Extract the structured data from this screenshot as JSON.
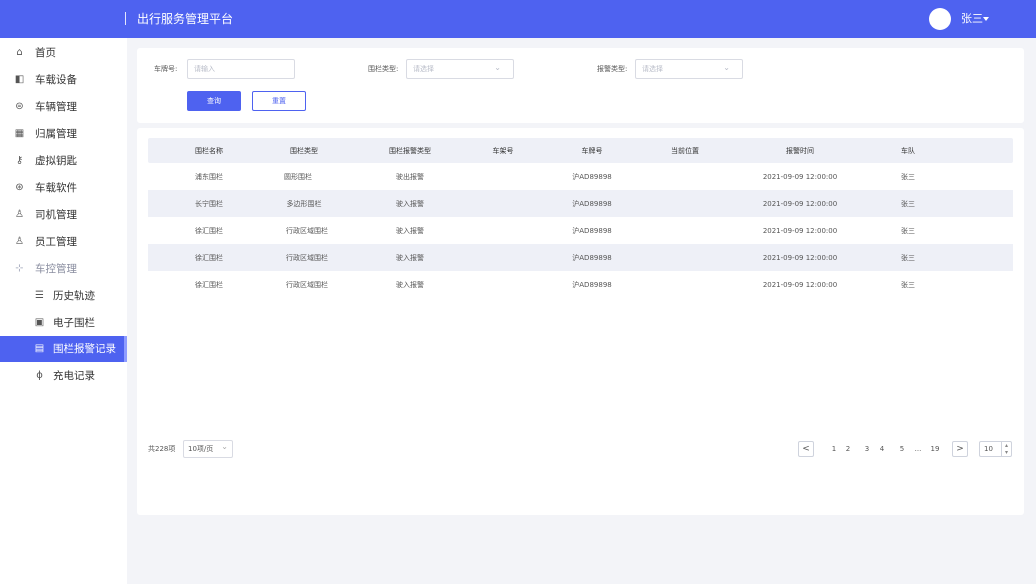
{
  "app": {
    "title": "出行服务管理平台",
    "user_name": "张三"
  },
  "sidebar": {
    "items": [
      {
        "label": "首页",
        "icon": "home-icon",
        "glyph": "⌂"
      },
      {
        "label": "车载设备",
        "icon": "device-icon",
        "glyph": "◧"
      },
      {
        "label": "车辆管理",
        "icon": "car-icon",
        "glyph": "⊜"
      },
      {
        "label": "归属管理",
        "icon": "grid-icon",
        "glyph": "▦"
      },
      {
        "label": "虚拟钥匙",
        "icon": "key-icon",
        "glyph": "⚷"
      },
      {
        "label": "车载软件",
        "icon": "cube-icon",
        "glyph": "⊛"
      },
      {
        "label": "司机管理",
        "icon": "driver-icon",
        "glyph": "♙"
      },
      {
        "label": "员工管理",
        "icon": "person-icon",
        "glyph": "♙"
      },
      {
        "label": "车控管理",
        "icon": "control-icon",
        "glyph": "⊹"
      },
      {
        "label": "历史轨迹",
        "icon": "list-icon",
        "glyph": "☰"
      },
      {
        "label": "电子围栏",
        "icon": "fence-icon",
        "glyph": "▣"
      },
      {
        "label": "围栏报警记录",
        "icon": "record-icon",
        "glyph": "▤"
      },
      {
        "label": "充电记录",
        "icon": "charge-icon",
        "glyph": "ϕ"
      }
    ]
  },
  "filter": {
    "plate_label": "车牌号:",
    "plate_placeholder": "请输入",
    "fence_type_label": "围栏类型:",
    "fence_type_placeholder": "请选择",
    "alarm_type_label": "报警类型:",
    "alarm_type_placeholder": "请选择",
    "search_label": "查询",
    "reset_label": "重置"
  },
  "table": {
    "columns": [
      "围栏名称",
      "围栏类型",
      "围栏报警类型",
      "车架号",
      "车牌号",
      "当前位置",
      "报警时间",
      "车队"
    ],
    "rows": [
      {
        "name": "浦东围栏",
        "type": "圆形围栏",
        "alarm": "驶出报警",
        "vin": "",
        "plate": "沪AD89898",
        "location": "",
        "time": "2021-09-09 12:00:00",
        "team": "张三"
      },
      {
        "name": "长宁围栏",
        "type": "多边形围栏",
        "alarm": "驶入报警",
        "vin": "",
        "plate": "沪AD89898",
        "location": "",
        "time": "2021-09-09 12:00:00",
        "team": "张三"
      },
      {
        "name": "徐汇围栏",
        "type": "行政区域围栏",
        "alarm": "驶入报警",
        "vin": "",
        "plate": "沪AD89898",
        "location": "",
        "time": "2021-09-09 12:00:00",
        "team": "张三"
      },
      {
        "name": "徐汇围栏",
        "type": "行政区域围栏",
        "alarm": "驶入报警",
        "vin": "",
        "plate": "沪AD89898",
        "location": "",
        "time": "2021-09-09 12:00:00",
        "team": "张三"
      },
      {
        "name": "徐汇围栏",
        "type": "行政区域围栏",
        "alarm": "驶入报警",
        "vin": "",
        "plate": "沪AD89898",
        "location": "",
        "time": "2021-09-09 12:00:00",
        "team": "张三"
      }
    ]
  },
  "pagination": {
    "total": "共228项",
    "page_size": "10项/页",
    "prev": "<",
    "next": ">",
    "pages": [
      "1",
      "2",
      "3",
      "4",
      "5",
      "...",
      "19"
    ],
    "jump_value": "10"
  },
  "colors": {
    "primary": "#4e62f0",
    "background": "#f3f4f8",
    "stripe": "#eef0f7"
  }
}
